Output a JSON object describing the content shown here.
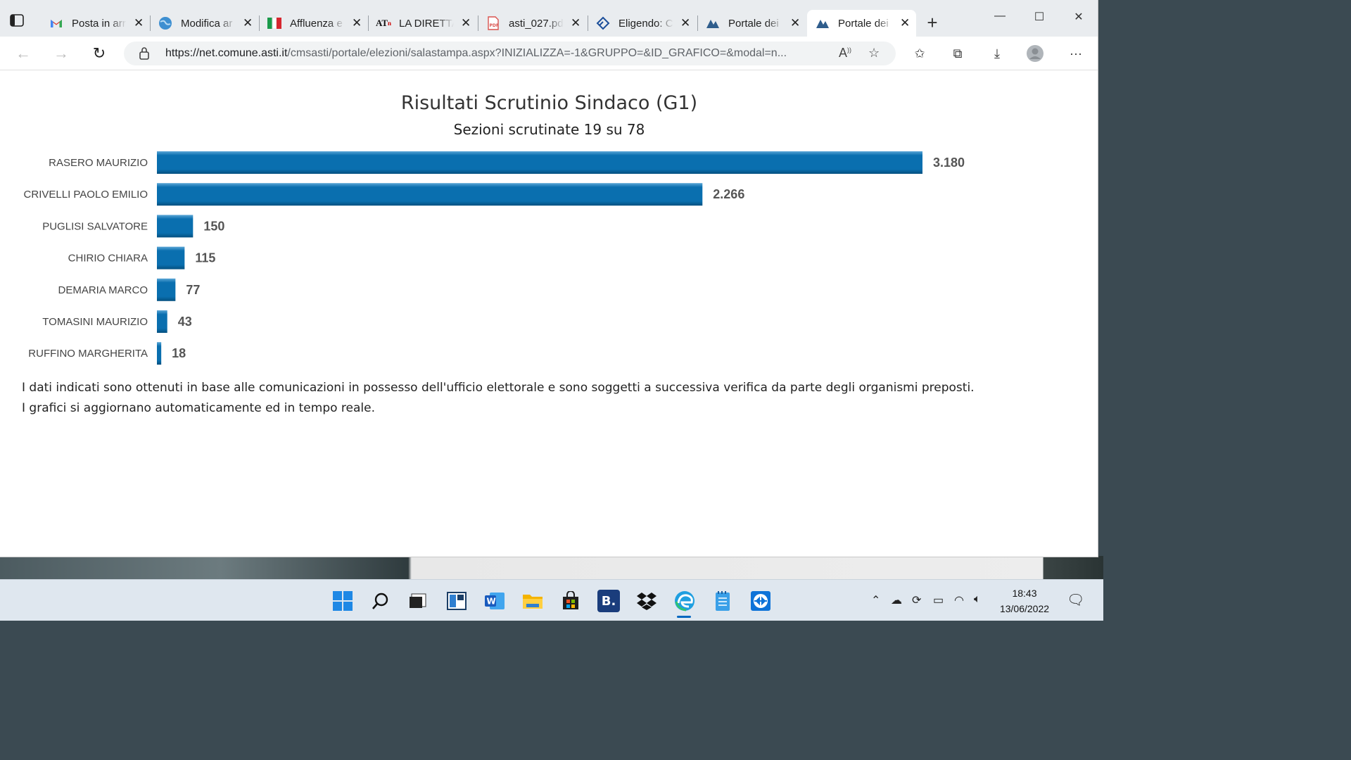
{
  "browser": {
    "tabs": [
      {
        "title": "Posta in arr",
        "icon": "gmail-icon"
      },
      {
        "title": "Modifica ar",
        "icon": "globe-icon"
      },
      {
        "title": "Affluenza e",
        "icon": "italy-flag-icon"
      },
      {
        "title": "LA DIRETTA",
        "icon": "atn-icon"
      },
      {
        "title": "asti_027.pd",
        "icon": "pdf-icon"
      },
      {
        "title": "Eligendo: C",
        "icon": "eligendo-icon"
      },
      {
        "title": "Portale dei",
        "icon": "portal-icon"
      },
      {
        "title": "Portale dei",
        "icon": "portal-icon",
        "active": true
      }
    ],
    "url_domain": "https://net.comune.asti.it",
    "url_path": "/cmsasti/portale/elezioni/salastampa.aspx?INIZIALIZZA=-1&GRUPPO=&ID_GRAFICO=&modal=n..."
  },
  "page": {
    "title": "Risultati Scrutinio Sindaco (G1)",
    "subtitle": "Sezioni scrutinate 19 su 78",
    "note_1": "I dati indicati sono ottenuti in base alle comunicazioni in possesso dell'ufficio elettorale e sono soggetti a successiva verifica da parte degli organismi preposti.",
    "note_2": "I grafici si aggiornano automaticamente ed in tempo reale."
  },
  "chart_data": {
    "type": "bar",
    "orientation": "horizontal",
    "categories": [
      "RASERO MAURIZIO",
      "CRIVELLI PAOLO EMILIO",
      "PUGLISI SALVATORE",
      "CHIRIO CHIARA",
      "DEMARIA MARCO",
      "TOMASINI MAURIZIO",
      "RUFFINO MARGHERITA"
    ],
    "values": [
      3180,
      2266,
      150,
      115,
      77,
      43,
      18
    ],
    "value_labels": [
      "3.180",
      "2.266",
      "150",
      "115",
      "77",
      "43",
      "18"
    ],
    "bar_color": "#0a6faf",
    "grid": false
  },
  "taskbar": {
    "time": "18:43",
    "date": "13/06/2022",
    "apps": [
      "windows-start-icon",
      "search-icon",
      "task-view-icon",
      "widgets-icon",
      "word-icon",
      "file-explorer-icon",
      "store-icon",
      "booking-icon",
      "dropbox-icon",
      "edge-icon",
      "notepad-icon",
      "teamviewer-icon"
    ]
  }
}
